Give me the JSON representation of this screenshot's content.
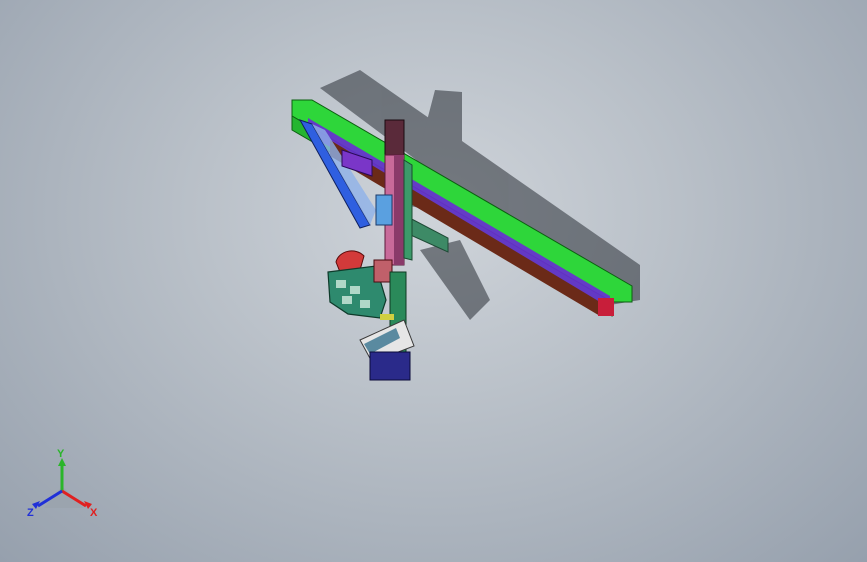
{
  "viewport": {
    "background_top": "#cfd4da",
    "background_bottom": "#96a0ad"
  },
  "triad": {
    "x_label": "X",
    "y_label": "Y",
    "z_label": "Z",
    "x_color": "#e02020",
    "y_color": "#2ab52a",
    "z_color": "#2030d8"
  },
  "model": {
    "beam_color": "#33d63a",
    "column_color": "#c8608a",
    "carriage_color": "#2a8c6a",
    "brace_color": "#2f5fe0",
    "rail_color": "#5a2a1a",
    "base_color": "#2a2a8a"
  }
}
